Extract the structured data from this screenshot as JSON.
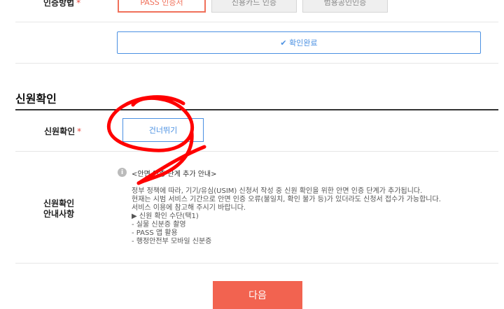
{
  "auth": {
    "label": "인증방법",
    "required_mark": "*",
    "methods": [
      "PASS 인증서",
      "신용카드 인증",
      "범용공인인증"
    ],
    "confirm_text": "✔ 확인완료"
  },
  "section": {
    "title": "신원확인"
  },
  "identity": {
    "label": "신원확인",
    "required_mark": "*",
    "skip_button": "건너뛰기"
  },
  "guide": {
    "label_line1": "신원확인",
    "label_line2": "안내사항",
    "info_icon": "i",
    "info_title": "<안면 인증 단계 추가 안내>",
    "lines": [
      "정부 정책에 따라, 기기/유심(USIM) 신청서 작성 중 신원 확인을 위한 안면 인증 단계가 추가됩니다.",
      "현재는 시범 서비스 기간으로 안면 인증 오류(불일치, 확인 불가 등)가 있더라도 신청서 접수가 가능합니다.",
      "서비스 이용에 참고해 주시기 바랍니다.",
      "▶ 신원 확인 수단(택1)",
      "- 실물 신분증 촬영",
      "- PASS 앱 활용",
      "- 행정안전부 모바일 신분증"
    ]
  },
  "footer": {
    "next_button": "다음"
  },
  "colors": {
    "accent": "#4a90e2",
    "primary": "#f26350",
    "annotation": "#ff0000"
  }
}
